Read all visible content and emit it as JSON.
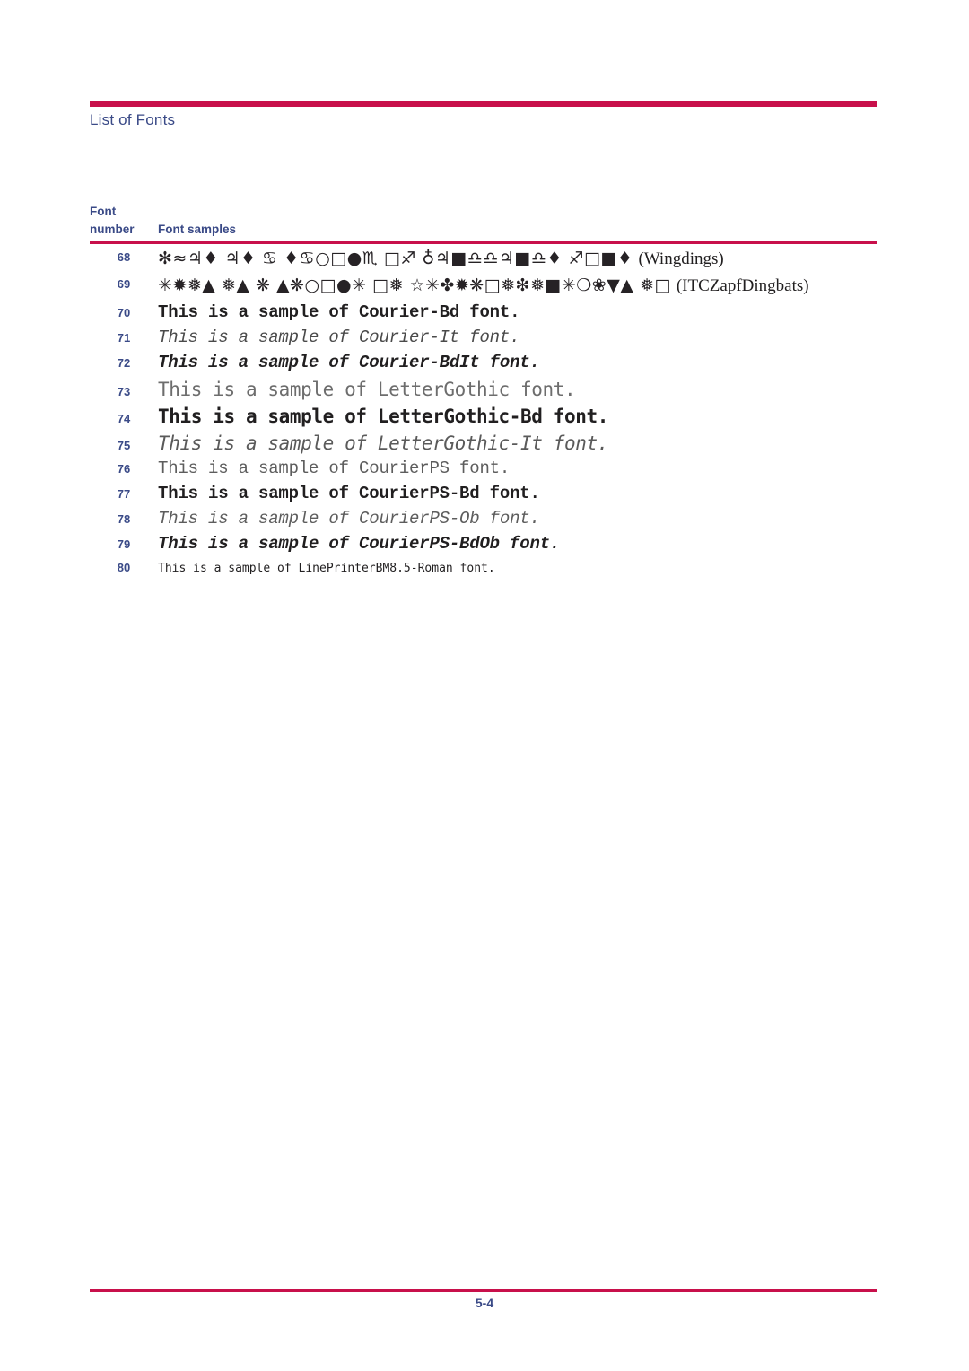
{
  "document": {
    "header_title": "List of Fonts",
    "page_number": "5-4",
    "accent_color": "#c8104b",
    "heading_color": "#3a4a87",
    "body_color": "#211f20"
  },
  "table": {
    "header": {
      "number_label_line1": "Font",
      "number_label_line2": "number",
      "samples_label": "Font samples"
    },
    "rows": [
      {
        "number": "68",
        "kind": "symbol",
        "glyphs": "✻≈♃♦ ♃♦ ♋ ♦♋○□●♏ □♐ ♁♃■♎♎♃■♎♦ ♐□■♦",
        "font_label": "(Wingdings)"
      },
      {
        "number": "69",
        "kind": "symbol",
        "glyphs": "✳✹❅▲ ❅▲ ❋ ▲❋○□●✳ □❅ ☆✳✤✹❋□❅❇❅■✳❍❀▼▲ ❅□",
        "font_label": "(ITCZapfDingbats)"
      },
      {
        "number": "70",
        "kind": "text",
        "text": "This is a sample of Courier-Bd font."
      },
      {
        "number": "71",
        "kind": "text",
        "text": "This is a sample of Courier-It font."
      },
      {
        "number": "72",
        "kind": "text",
        "text": "This is a sample of Courier-BdIt font."
      },
      {
        "number": "73",
        "kind": "text",
        "text": "This is a sample of LetterGothic font."
      },
      {
        "number": "74",
        "kind": "text",
        "text": "This is a sample of LetterGothic-Bd font."
      },
      {
        "number": "75",
        "kind": "text",
        "text": "This is a sample of LetterGothic-It font."
      },
      {
        "number": "76",
        "kind": "text",
        "text": "This is a sample of CourierPS font."
      },
      {
        "number": "77",
        "kind": "text",
        "text": "This is a sample of CourierPS-Bd font."
      },
      {
        "number": "78",
        "kind": "text",
        "text": "This is a sample of CourierPS-Ob font."
      },
      {
        "number": "79",
        "kind": "text",
        "text": "This is a sample of CourierPS-BdOb font."
      },
      {
        "number": "80",
        "kind": "text",
        "text": "This is a sample of LinePrinterBM8.5-Roman font."
      }
    ]
  }
}
